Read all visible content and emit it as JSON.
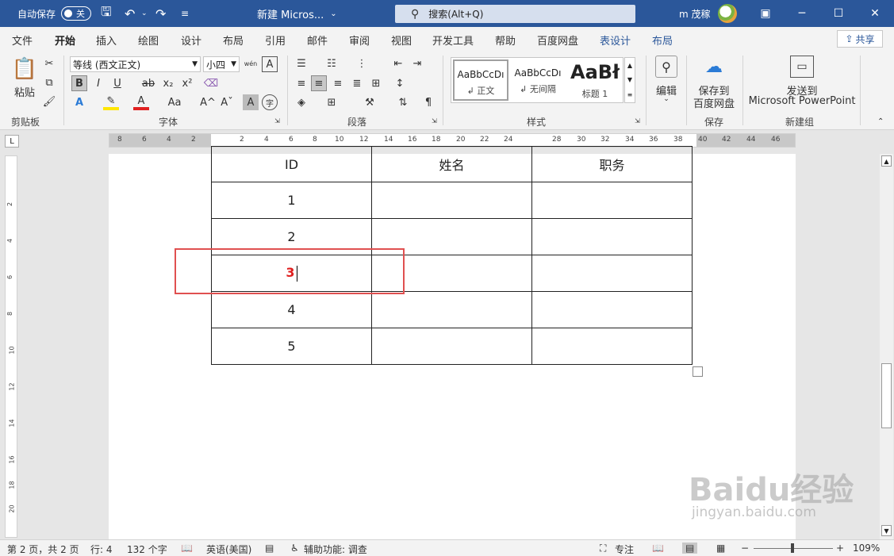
{
  "titlebar": {
    "autosave_label": "自动保存",
    "autosave_state": "关",
    "doc_title": "新建 Micros...",
    "title_chevron": "⌄",
    "search_placeholder": "搜索(Alt+Q)",
    "user_name": "m 茂稼"
  },
  "tabs": [
    "文件",
    "开始",
    "插入",
    "绘图",
    "设计",
    "布局",
    "引用",
    "邮件",
    "审阅",
    "视图",
    "开发工具",
    "帮助",
    "百度网盘",
    "表设计",
    "布局"
  ],
  "share_label": "共享",
  "ribbon": {
    "clipboard": {
      "paste_label": "粘贴",
      "group_label": "剪贴板"
    },
    "font": {
      "font_name": "等线 (西文正文)",
      "font_size": "小四",
      "group_label": "字体",
      "buttons": {
        "bold": "B",
        "italic": "I",
        "underline": "U",
        "strike": "ab",
        "subscript": "x₂",
        "superscript": "x²",
        "text_effects": "A",
        "font_color": "A",
        "change_case": "Aa",
        "grow": "A^",
        "shrink": "Aˇ",
        "char_shade": "A",
        "enclose": "字",
        "phonetic": "wén",
        "border": "A"
      }
    },
    "paragraph": {
      "group_label": "段落"
    },
    "styles": {
      "group_label": "样式",
      "items": [
        {
          "preview": "AaBbCcDı",
          "name": "↲ 正文"
        },
        {
          "preview": "AaBbCcDı",
          "name": "↲ 无间隔"
        },
        {
          "preview": "AaBł",
          "name": "标题 1"
        }
      ]
    },
    "editing": {
      "label": "编辑"
    },
    "save": {
      "label_line1": "保存到",
      "label_line2": "百度网盘",
      "group_label": "保存"
    },
    "new_group": {
      "label_line1": "发送到",
      "label_line2": "Microsoft PowerPoint",
      "group_label": "新建组"
    }
  },
  "ruler": {
    "ticks_left": [
      "8",
      "6",
      "4",
      "2"
    ],
    "ticks_mid": [
      "2",
      "4",
      "6",
      "8",
      "10",
      "12",
      "14",
      "16",
      "18",
      "20",
      "22",
      "24"
    ],
    "ticks_right": [
      "28",
      "30",
      "32",
      "34",
      "36",
      "38",
      "40",
      "42",
      "44",
      "46"
    ],
    "corner": "L",
    "vticks": [
      "2",
      "4",
      "6",
      "8",
      "10",
      "12",
      "14",
      "16",
      "18",
      "20"
    ]
  },
  "table": {
    "headers": [
      "ID",
      "姓名",
      "职务"
    ],
    "rows": [
      [
        "1",
        "",
        ""
      ],
      [
        "2",
        "",
        ""
      ],
      [
        "3",
        "",
        ""
      ],
      [
        "4",
        "",
        ""
      ],
      [
        "5",
        "",
        ""
      ]
    ],
    "highlight_color": "#e02020"
  },
  "statusbar": {
    "page": "第 2 页，共 2 页",
    "line": "行: 4",
    "words": "132 个字",
    "language": "英语(美国)",
    "accessibility": "辅助功能: 调查",
    "focus": "专注",
    "zoom": "109%"
  },
  "watermark": {
    "main": "Baidu经验",
    "sub": "jingyan.baidu.com"
  },
  "colors": {
    "accent": "#2b579a",
    "highlight": "#e05050"
  }
}
